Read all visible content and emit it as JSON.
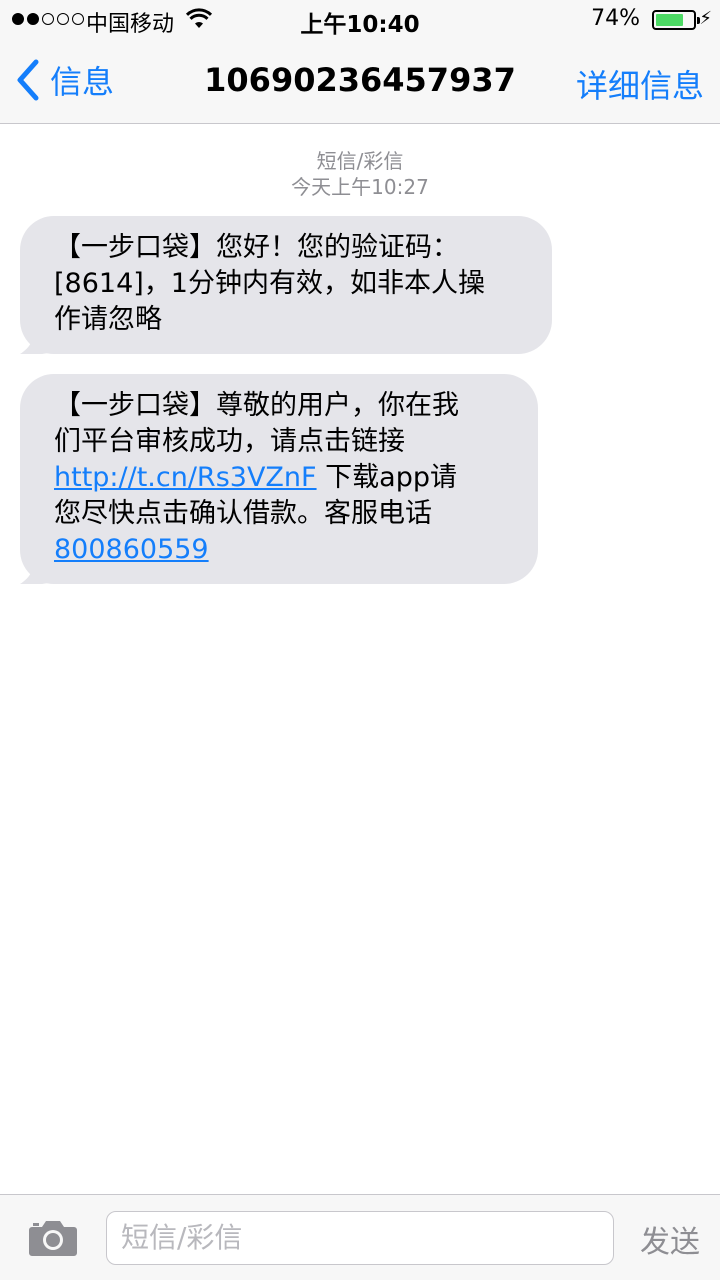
{
  "status_bar": {
    "carrier": "中国移动",
    "time": "上午10:40",
    "battery_percent_label": "74%",
    "battery_level": 0.74,
    "signal_strength": 2,
    "signal_max": 5,
    "colors": {
      "battery": "#4cd964"
    }
  },
  "nav": {
    "back_label": "信息",
    "title": "10690236457937",
    "detail_label": "详细信息",
    "colors": {
      "accent": "#147efb"
    }
  },
  "thread": {
    "type_label": "短信/彩信",
    "timestamp": "今天上午10:27"
  },
  "messages": [
    {
      "line1": "【一步口袋】您好！您的验证码：",
      "line2": "[8614]，1分钟内有效，如非本人操",
      "line3": "作请忽略"
    },
    {
      "line1": "【一步口袋】尊敬的用户，你在我",
      "line2": "们平台审核成功，请点击链接",
      "link": "http://t.cn/Rs3VZnF",
      "after_link": " 下载app请",
      "line4": "您尽快点击确认借款。客服电话",
      "phone": "800860559"
    }
  ],
  "input_bar": {
    "placeholder": "短信/彩信",
    "send_label": "发送",
    "icons": {
      "camera": "camera-icon"
    }
  },
  "colors": {
    "bubble_incoming": "#e5e5ea",
    "link": "#147efb",
    "bar_background": "#f7f7f7"
  }
}
